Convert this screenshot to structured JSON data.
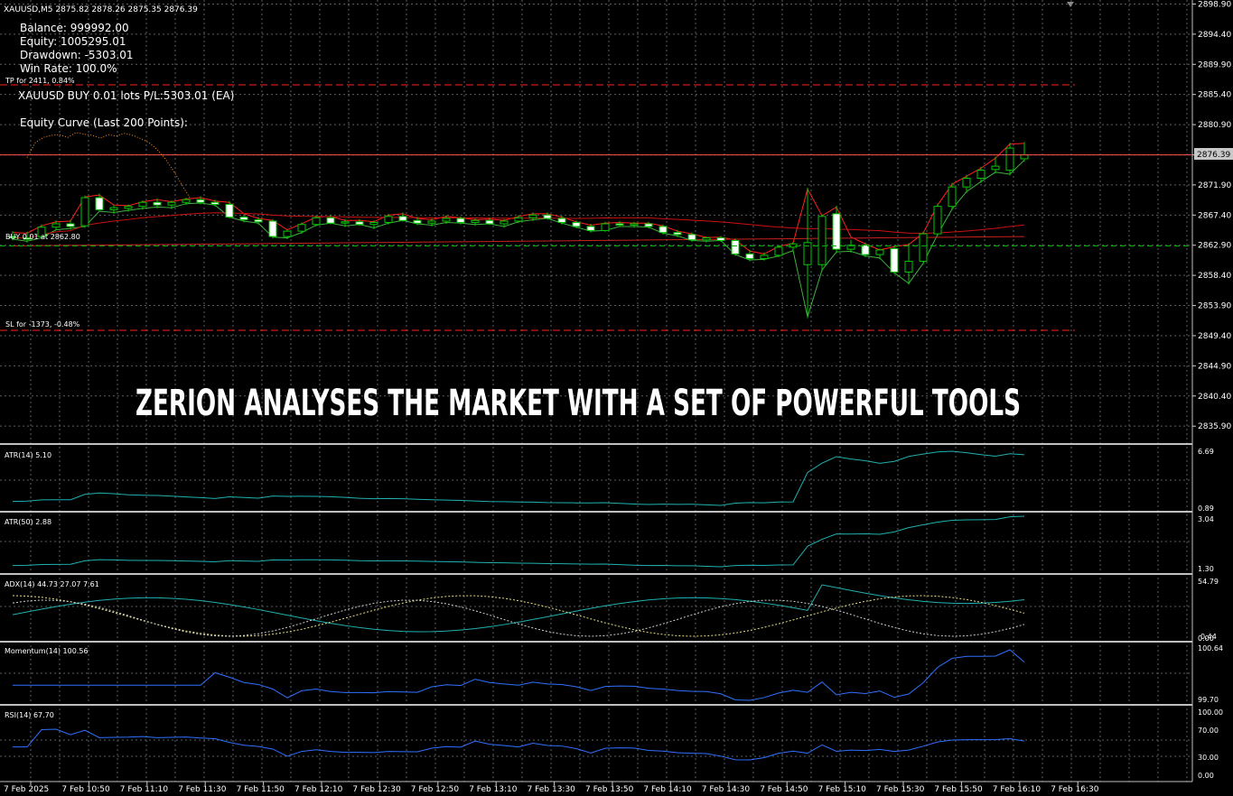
{
  "colors": {
    "background": "#000000",
    "grid": "#5a5f66",
    "axis_text": "#ffffff",
    "bull_candle": "#ffffff",
    "bear_candle": "#ffffff",
    "candle_outline": "#00c800",
    "ma_fast": "#ff2020",
    "ma_slow": "#cc1010",
    "price_line": "#ff5050",
    "buy_line": "#00b000",
    "sl_line": "#ff2020",
    "tp_line": "#ff2020",
    "indicator_line": "#20b0b0",
    "adx_di_plus": "#e8e080",
    "adx_di_minus": "#d0d0d0",
    "momentum_line": "#3070ff",
    "rsi_line": "#3070ff",
    "equity_curve": "#ff9020",
    "separator": "#c0c0c0",
    "overlay_title": "#ffffff"
  },
  "symbol_info": "XAUUSD,M5  2875.82 2878.26 2875.35 2876.39",
  "stats": {
    "balance": "Balance: 999992.00",
    "equity": "Equity: 1005295.01",
    "drawdown": "Drawdown: -5303.01",
    "win_rate": "Win Rate: 100.0%"
  },
  "position_text": "XAUUSD BUY 0.01 lots P/L:5303.01 (EA)",
  "equity_label": "Equity Curve (Last 200 Points):",
  "tp_label": "TP for 2411, 0.84%",
  "buy_label": "BUY 0.01 at 2862.80",
  "sl_label": "SL for -1373, -0.48%",
  "current_price": "2876.39",
  "overlay_title": "ZERION ANALYSES THE MARKET WITH A SET OF POWERFUL TOOLS",
  "indicators": {
    "atr14": {
      "label": "ATR(14) 5.10",
      "max": "6.69",
      "min": "0.89"
    },
    "atr50": {
      "label": "ATR(50) 2.88",
      "max": "3.04",
      "min": "1.30"
    },
    "adx": {
      "label": "ADX(14) 44.73 27.07 7.61",
      "max": "54.79",
      "min_a": "0.44",
      "min_b": "0.00"
    },
    "momentum": {
      "label": "Momentum(14) 100.56",
      "max": "100.64",
      "min": "99.70"
    },
    "rsi": {
      "label": "RSI(14) 67.70",
      "levels": [
        "100.00",
        "70.00",
        "30.00",
        "0.00"
      ]
    }
  },
  "price_axis": [
    "2898.90",
    "2894.40",
    "2889.90",
    "2885.40",
    "2880.90",
    "2876.39",
    "2871.90",
    "2867.40",
    "2862.90",
    "2858.40",
    "2853.90",
    "2849.40",
    "2844.90",
    "2840.40",
    "2835.90"
  ],
  "time_axis": [
    "7 Feb 2025",
    "7 Feb 10:50",
    "7 Feb 11:10",
    "7 Feb 11:30",
    "7 Feb 11:50",
    "7 Feb 12:10",
    "7 Feb 12:30",
    "7 Feb 12:50",
    "7 Feb 13:10",
    "7 Feb 13:30",
    "7 Feb 13:50",
    "7 Feb 14:10",
    "7 Feb 14:30",
    "7 Feb 14:50",
    "7 Feb 15:10",
    "7 Feb 15:30",
    "7 Feb 15:50",
    "7 Feb 16:10",
    "7 Feb 16:30"
  ],
  "chart_data": {
    "type": "candlestick",
    "price_range": [
      2833.5,
      2899.5
    ],
    "candles": [
      [
        2864.2,
        2865.0,
        2863.6,
        2864.0
      ],
      [
        2864.0,
        2864.9,
        2863.3,
        2863.9
      ],
      [
        2864.2,
        2866.0,
        2863.8,
        2865.6
      ],
      [
        2865.6,
        2866.6,
        2865.1,
        2866.1
      ],
      [
        2866.1,
        2866.7,
        2865.2,
        2865.7
      ],
      [
        2865.8,
        2870.3,
        2865.5,
        2870.0
      ],
      [
        2870.0,
        2870.6,
        2868.0,
        2868.2
      ],
      [
        2868.2,
        2868.9,
        2867.6,
        2868.5
      ],
      [
        2868.4,
        2869.0,
        2867.9,
        2868.7
      ],
      [
        2868.7,
        2869.6,
        2868.2,
        2869.3
      ],
      [
        2869.3,
        2869.9,
        2868.4,
        2868.9
      ],
      [
        2868.9,
        2869.6,
        2868.3,
        2869.3
      ],
      [
        2869.3,
        2870.0,
        2868.9,
        2869.7
      ],
      [
        2869.7,
        2870.2,
        2869.0,
        2869.3
      ],
      [
        2869.3,
        2869.7,
        2868.7,
        2869.0
      ],
      [
        2869.0,
        2869.5,
        2866.9,
        2867.1
      ],
      [
        2867.1,
        2867.5,
        2866.3,
        2866.7
      ],
      [
        2866.7,
        2867.1,
        2866.0,
        2866.4
      ],
      [
        2866.5,
        2866.8,
        2863.9,
        2864.2
      ],
      [
        2864.2,
        2865.2,
        2863.8,
        2865.0
      ],
      [
        2865.0,
        2866.3,
        2864.6,
        2866.0
      ],
      [
        2866.0,
        2867.3,
        2865.7,
        2867.0
      ],
      [
        2867.0,
        2867.4,
        2866.0,
        2866.2
      ],
      [
        2866.2,
        2866.8,
        2865.6,
        2866.4
      ],
      [
        2866.4,
        2866.8,
        2865.8,
        2866.0
      ],
      [
        2866.0,
        2866.6,
        2865.3,
        2866.3
      ],
      [
        2866.3,
        2867.6,
        2866.0,
        2867.2
      ],
      [
        2867.2,
        2867.8,
        2866.4,
        2866.6
      ],
      [
        2866.6,
        2867.1,
        2865.9,
        2866.2
      ],
      [
        2866.2,
        2866.9,
        2865.7,
        2866.5
      ],
      [
        2866.5,
        2867.4,
        2866.1,
        2866.9
      ],
      [
        2866.9,
        2867.2,
        2866.0,
        2866.3
      ],
      [
        2866.3,
        2866.9,
        2865.8,
        2866.6
      ],
      [
        2866.6,
        2867.0,
        2865.9,
        2866.1
      ],
      [
        2866.1,
        2866.8,
        2865.5,
        2866.5
      ],
      [
        2866.5,
        2867.4,
        2866.2,
        2867.0
      ],
      [
        2867.0,
        2867.8,
        2866.5,
        2867.4
      ],
      [
        2867.4,
        2867.8,
        2866.7,
        2866.9
      ],
      [
        2866.9,
        2867.3,
        2866.0,
        2866.3
      ],
      [
        2866.3,
        2866.6,
        2865.4,
        2865.7
      ],
      [
        2865.7,
        2866.1,
        2864.8,
        2865.1
      ],
      [
        2865.1,
        2866.4,
        2864.9,
        2866.1
      ],
      [
        2866.1,
        2866.5,
        2865.6,
        2865.9
      ],
      [
        2865.9,
        2866.4,
        2865.5,
        2866.1
      ],
      [
        2866.1,
        2866.4,
        2865.4,
        2865.7
      ],
      [
        2865.7,
        2866.0,
        2864.5,
        2864.8
      ],
      [
        2864.8,
        2865.2,
        2864.1,
        2864.5
      ],
      [
        2864.5,
        2864.8,
        2863.4,
        2863.7
      ],
      [
        2863.7,
        2864.2,
        2863.3,
        2864.0
      ],
      [
        2864.0,
        2864.3,
        2863.4,
        2863.6
      ],
      [
        2863.6,
        2863.9,
        2861.3,
        2861.6
      ],
      [
        2861.6,
        2862.2,
        2860.5,
        2860.9
      ],
      [
        2860.9,
        2861.8,
        2860.6,
        2861.4
      ],
      [
        2861.4,
        2862.9,
        2861.1,
        2862.6
      ],
      [
        2862.6,
        2863.4,
        2861.9,
        2863.1
      ],
      [
        2860.0,
        2871.5,
        2852.0,
        2863.3
      ],
      [
        2860.0,
        2867.5,
        2859.0,
        2867.2
      ],
      [
        2867.6,
        2868.8,
        2861.7,
        2862.3
      ],
      [
        2862.3,
        2863.7,
        2861.8,
        2862.9
      ],
      [
        2862.9,
        2863.3,
        2861.1,
        2861.5
      ],
      [
        2861.5,
        2862.4,
        2860.8,
        2862.2
      ],
      [
        2862.4,
        2862.9,
        2858.6,
        2858.9
      ],
      [
        2858.9,
        2863.2,
        2857.0,
        2860.5
      ],
      [
        2860.5,
        2864.9,
        2860.0,
        2864.6
      ],
      [
        2864.6,
        2869.1,
        2864.3,
        2868.7
      ],
      [
        2868.7,
        2872.2,
        2868.2,
        2871.6
      ],
      [
        2871.6,
        2873.4,
        2870.7,
        2872.9
      ],
      [
        2872.9,
        2874.6,
        2872.2,
        2874.1
      ],
      [
        2874.2,
        2876.1,
        2873.6,
        2874.7
      ],
      [
        2874.1,
        2878.2,
        2873.3,
        2877.4
      ],
      [
        2875.8,
        2878.3,
        2875.4,
        2876.4
      ]
    ],
    "equity_curve": [
      2876.0,
      2878.2,
      2879.0,
      2879.3,
      2879.4,
      2879.0,
      2879.7,
      2879.5,
      2879.3,
      2878.9,
      2879.4,
      2879.2,
      2879.6,
      2879.3,
      2878.8,
      2878.2,
      2877.2,
      2875.8,
      2874.0,
      2872.0,
      2870.0
    ]
  }
}
